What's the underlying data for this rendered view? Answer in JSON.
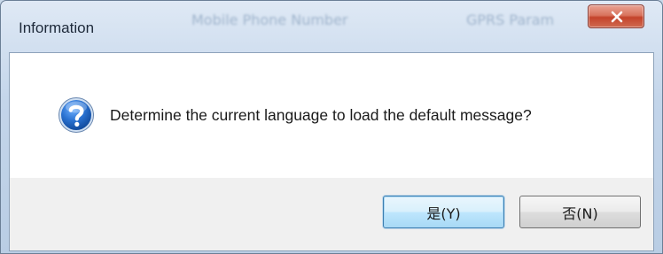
{
  "window": {
    "title": "Information",
    "background_titles": [
      "Mobile Phone Number",
      "GPRS Param"
    ],
    "close_icon": "close-icon"
  },
  "dialog": {
    "icon": "question-icon",
    "message": "Determine the current language to load the default message?"
  },
  "buttons": {
    "yes_label": "是(Y)",
    "no_label": "否(N)"
  },
  "colors": {
    "title_bar": "#c3d5ea",
    "close_button": "#c4432b",
    "question_icon": "#1f62b8",
    "default_button_border": "#3c7fb1"
  }
}
